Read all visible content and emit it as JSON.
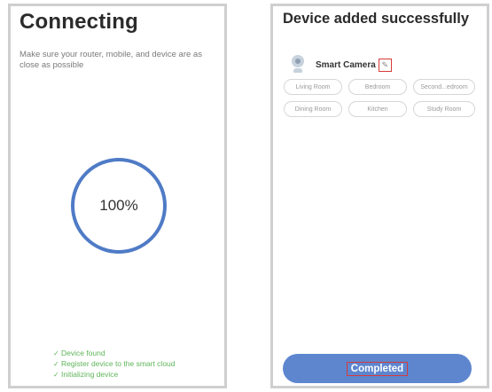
{
  "connecting": {
    "title": "Connecting",
    "description": "Make sure your router, mobile, and device are as close as possible",
    "progress_text": "100%",
    "progress": 100,
    "steps": [
      {
        "check": "✓",
        "label": "Device found"
      },
      {
        "check": "✓",
        "label": "Register device to the smart cloud"
      },
      {
        "check": "✓",
        "label": "Initializing device"
      }
    ],
    "colors": {
      "ring": "#4f7bc6",
      "steps": "#5fb55a"
    }
  },
  "added": {
    "title": "Device added successfully",
    "device_name": "Smart Camera",
    "device_icon": "camera-icon",
    "edit_icon": "pencil-icon",
    "rooms": [
      "Living Room",
      "Bedroom",
      "Second...edroom",
      "Dining Room",
      "Kitchen",
      "Study Room"
    ],
    "button_label": "Completed",
    "colors": {
      "button": "#5d86cf",
      "highlight": "#d63b3b"
    }
  }
}
